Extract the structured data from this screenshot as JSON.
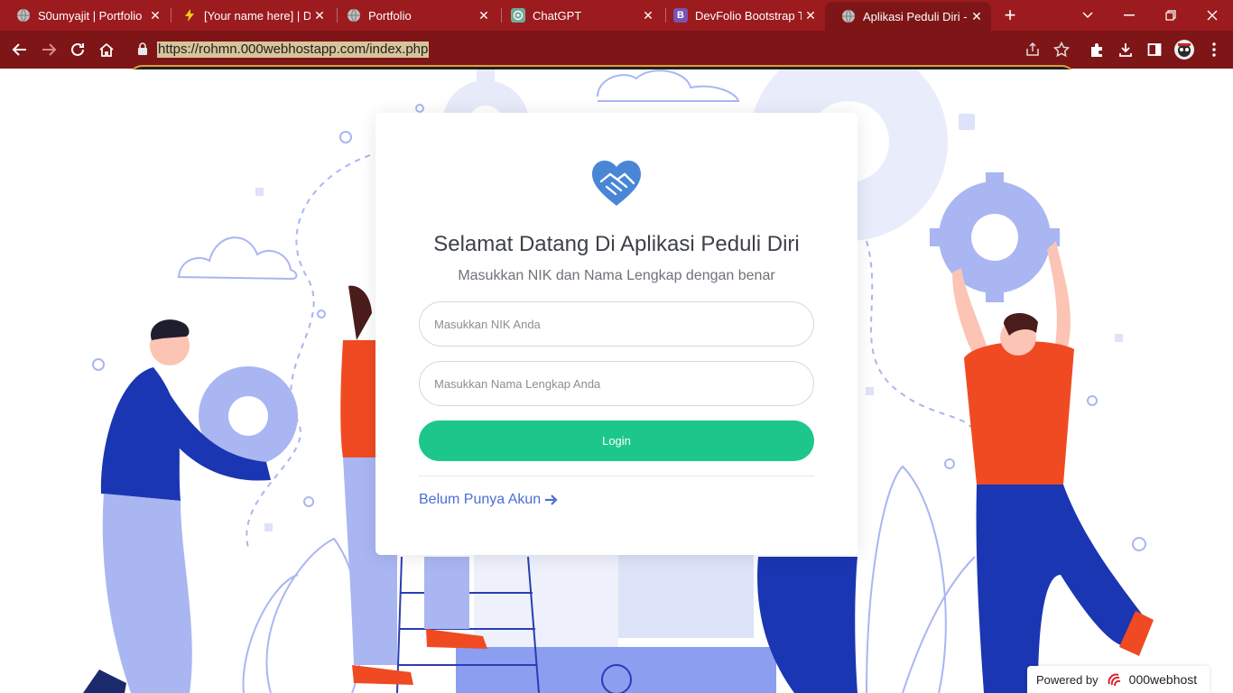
{
  "browser": {
    "tabs": [
      {
        "title": "S0umyajit | Portfolio",
        "icon": "globe-icon",
        "active": false
      },
      {
        "title": "[Your name here] | De",
        "icon": "bolt-icon",
        "active": false
      },
      {
        "title": "Portfolio",
        "icon": "globe-icon",
        "active": false
      },
      {
        "title": "ChatGPT",
        "icon": "chatgpt-icon",
        "active": false
      },
      {
        "title": "DevFolio Bootstrap Te",
        "icon": "bootstrap-icon",
        "active": false
      },
      {
        "title": "Aplikasi Peduli Diri - I",
        "icon": "globe-icon",
        "active": true
      }
    ],
    "bootstrap_letter": "B",
    "new_tab": "+",
    "url": "https://rohmn.000webhostapp.com/index.php",
    "theme_color": "#9c1b1e"
  },
  "login": {
    "title": "Selamat Datang Di Aplikasi Peduli Diri",
    "subtitle": "Masukkan NIK dan Nama Lengkap dengan benar",
    "nik_placeholder": "Masukkan NIK Anda",
    "name_placeholder": "Masukkan Nama Lengkap Anda",
    "login_label": "Login",
    "register_link": "Belum Punya Akun",
    "logo_icon": "heart-handshake-icon",
    "accent_color": "#1dc78a",
    "link_color": "#4a6fd6"
  },
  "footer": {
    "powered_by": "Powered by",
    "brand": "000webhost"
  }
}
